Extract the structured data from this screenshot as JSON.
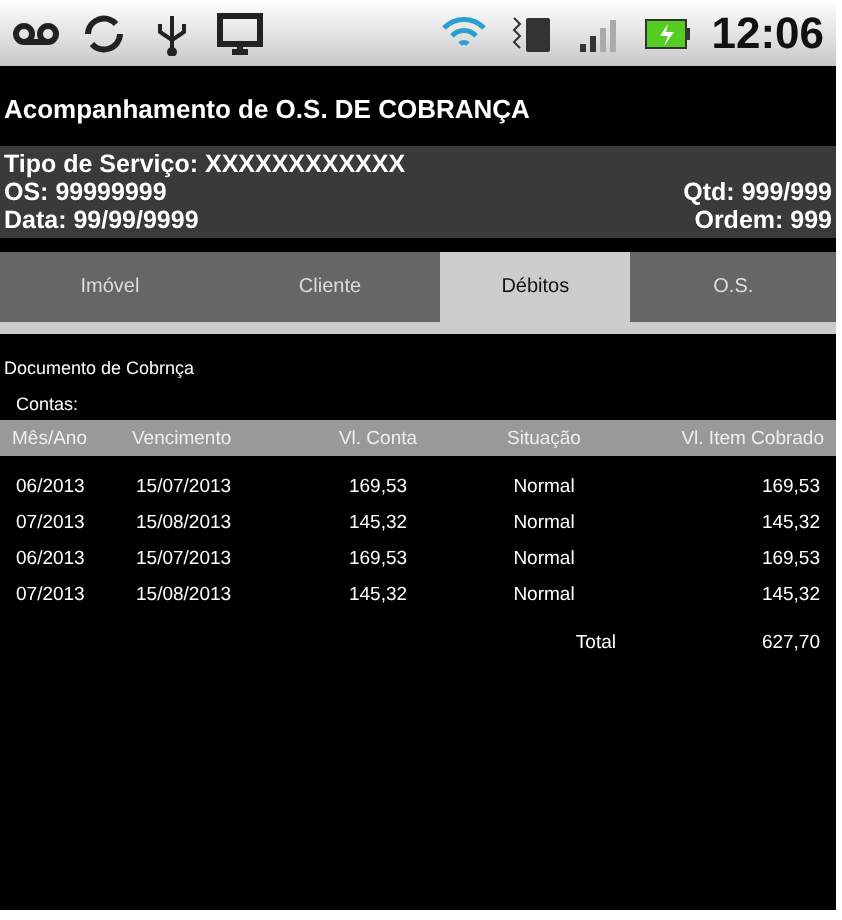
{
  "status_bar": {
    "time": "12:06"
  },
  "title": "Acompanhamento de O.S. DE COBRANÇA",
  "header": {
    "service": "Tipo de Serviço: XXXXXXXXXXXX",
    "os": "OS: 99999999",
    "qtd": "Qtd: 999/999",
    "date": "Data: 99/99/9999",
    "order": "Ordem: 999"
  },
  "tabs": [
    {
      "label": "Imóvel",
      "selected": false
    },
    {
      "label": "Cliente",
      "selected": false
    },
    {
      "label": "Débitos",
      "selected": true
    },
    {
      "label": "O.S.",
      "selected": false
    }
  ],
  "section_title": "Documento de Cobrnça",
  "list_label": "Contas:",
  "table": {
    "columns": [
      "Mês/Ano",
      "Vencimento",
      "Vl. Conta",
      "Situação",
      "Vl. Item Cobrado"
    ],
    "rows": [
      [
        "06/2013",
        "15/07/2013",
        "169,53",
        "Normal",
        "169,53"
      ],
      [
        "07/2013",
        "15/08/2013",
        "145,32",
        "Normal",
        "145,32"
      ],
      [
        "06/2013",
        "15/07/2013",
        "169,53",
        "Normal",
        "169,53"
      ],
      [
        "07/2013",
        "15/08/2013",
        "145,32",
        "Normal",
        "145,32"
      ]
    ],
    "total_label": "Total",
    "total_value": "627,70"
  }
}
